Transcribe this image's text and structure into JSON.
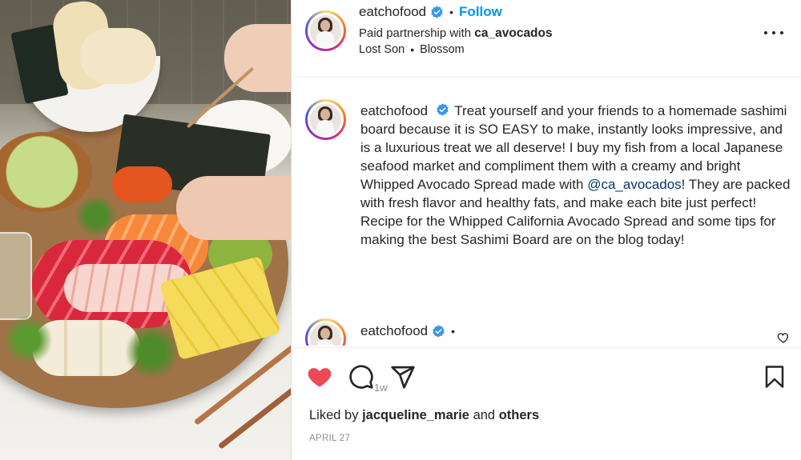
{
  "post": {
    "username": "eatchofood",
    "follow_label": "Follow",
    "separator": "•",
    "partnership_prefix": "Paid partnership with",
    "partner": "ca_avocados",
    "audio_artist": "Lost Son",
    "audio_track": "Blossom",
    "caption_before_mention": "Treat yourself and your friends to a homemade sashimi board because it is SO EASY to make, instantly looks impressive, and is a luxurious treat we all deserve! I buy my fish from a local Japanese seafood market and compliment them with a creamy and bright Whipped Avocado Spread made with",
    "caption_mention": "@ca_avocados",
    "caption_after_mention": "! They are packed with fresh flavor and healthy fats, and make each bite just perfect! Recipe for the Whipped California Avocado Spread and some tips for making the best Sashimi Board are on the blog today!",
    "time_ago": "1w",
    "comment_username": "eatchofood",
    "liked_by_prefix": "Liked by",
    "liked_by_user": "jacqueline_marie",
    "liked_by_and": "and",
    "liked_by_others": "others",
    "date": "APRIL 27"
  },
  "colors": {
    "like_red": "#ed4956",
    "link_blue": "#0095f6",
    "verified_blue": "#3897f0",
    "mention_blue": "#00376b"
  },
  "icons": [
    "verified-badge-icon",
    "more-options-icon",
    "heart-filled-icon",
    "comment-icon",
    "share-icon",
    "bookmark-icon",
    "heart-outline-icon"
  ]
}
